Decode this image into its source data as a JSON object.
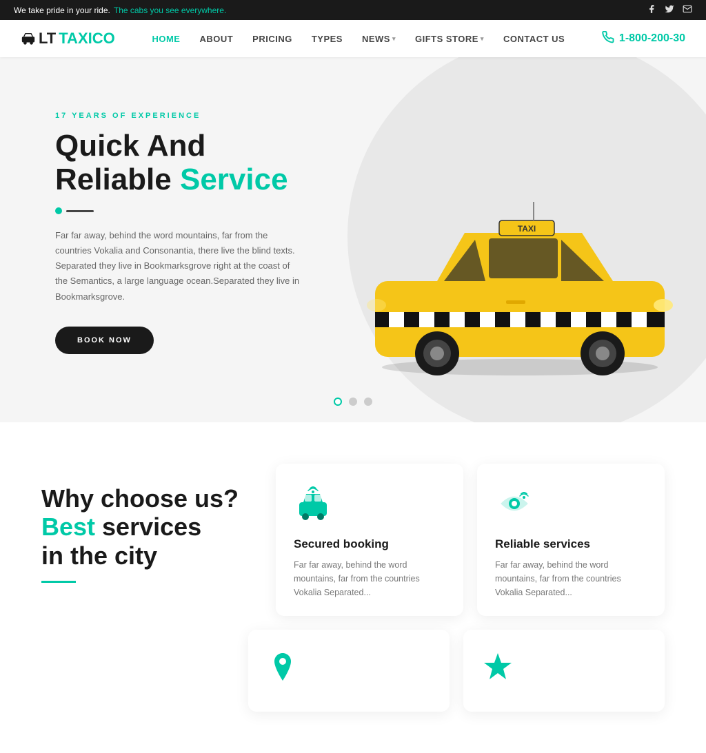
{
  "topbar": {
    "message_start": "We take pride in your ride.",
    "message_highlight": "The cabs you see everywhere.",
    "social": {
      "facebook": "f",
      "twitter": "t",
      "email": "✉"
    }
  },
  "header": {
    "logo_lt": "LT",
    "logo_taxico": "TAXICO",
    "nav": [
      {
        "label": "HOME",
        "active": true,
        "has_dropdown": false
      },
      {
        "label": "ABOUT",
        "active": false,
        "has_dropdown": false
      },
      {
        "label": "PRICING",
        "active": false,
        "has_dropdown": false
      },
      {
        "label": "TYPES",
        "active": false,
        "has_dropdown": false
      },
      {
        "label": "NEWS",
        "active": false,
        "has_dropdown": true
      },
      {
        "label": "GIFTS STORE",
        "active": false,
        "has_dropdown": true
      },
      {
        "label": "CONTACT US",
        "active": false,
        "has_dropdown": false
      }
    ],
    "phone": "1-800-200-30"
  },
  "hero": {
    "subtitle": "17 YEARS OF EXPERIENCE",
    "title_line1": "Quick And",
    "title_line2_normal": "Reliable",
    "title_line2_highlight": "Service",
    "description": "Far far away, behind the word mountains, far from the countries Vokalia and Consonantia, there live the blind texts. Separated they live in Bookmarksgrove right at the coast of the Semantics, a large language ocean.Separated they live in Bookmarksgrove.",
    "cta_label": "BOOK NOW",
    "slider_dots": [
      true,
      false,
      false
    ]
  },
  "features_heading": {
    "why": "Why choose us?",
    "best": "Best",
    "services": " services",
    "city": "in the city"
  },
  "feature_cards": [
    {
      "id": "secured-booking",
      "icon": "taxi-icon",
      "title": "Secured booking",
      "desc": "Far far away, behind the word mountains, far from the countries Vokalia Separated..."
    },
    {
      "id": "reliable-services",
      "icon": "eye-icon",
      "title": "Reliable services",
      "desc": "Far far away, behind the word mountains, far from the countries Vokalia Separated..."
    }
  ],
  "feature_cards_bottom": [
    {
      "id": "card-3",
      "icon": "location-icon"
    },
    {
      "id": "card-4",
      "icon": "star-icon"
    }
  ],
  "colors": {
    "accent": "#00c9a7",
    "dark": "#1a1a1a",
    "gray": "#f5f5f5"
  }
}
